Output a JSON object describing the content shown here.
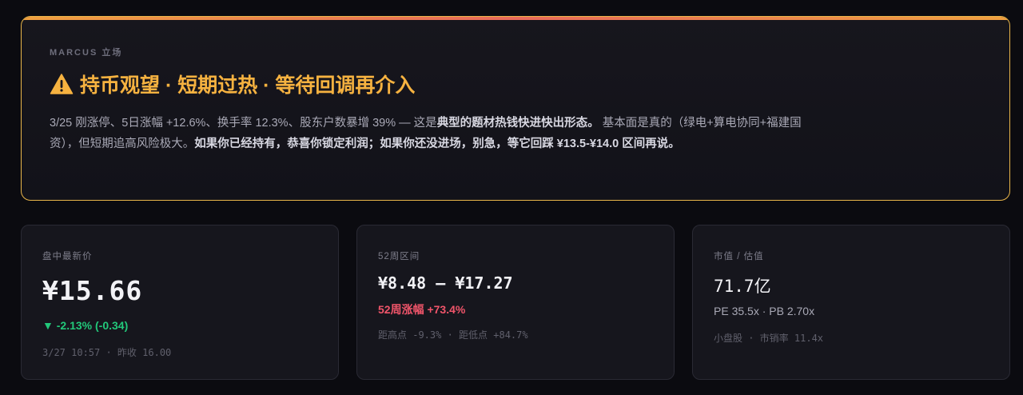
{
  "stance": {
    "label": "MARCUS 立场",
    "title": "持币观望 · 短期过热 · 等待回调再介入",
    "body_1": "3/25 刚涨停、5日涨幅 +12.6%、换手率 12.3%、股东户数暴增 39% — 这是",
    "body_2": "典型的题材热钱快进快出形态。",
    "body_3": " 基本面是真的（绿电+算电协同+福建国资），但短期追高风险极大。",
    "body_4": "如果你已经持有，恭喜你锁定利润；如果你还没进场，别急，等它回踩 ¥13.5-¥14.0 区间再说。",
    "accent_color": "#f6b240",
    "icon": "warning-icon"
  },
  "cards": {
    "price": {
      "label": "盘中最新价",
      "value": "¥15.66",
      "change": "▼ -2.13% (-0.34)",
      "sub": "3/27 10:57 · 昨收 16.00"
    },
    "range": {
      "label": "52周区间",
      "value": "¥8.48 — ¥17.27",
      "gain": "52周涨幅 +73.4%",
      "sub": "距高点 -9.3% · 距低点 +84.7%"
    },
    "valuation": {
      "label": "市值 / 估值",
      "value": "71.7亿",
      "ratios": "PE 35.5x · PB 2.70x",
      "sub": "小盘股 · 市销率 11.4x"
    }
  },
  "colors": {
    "down": "#22c87a",
    "up": "#f0556a",
    "border_accent": "#e8b54a"
  }
}
